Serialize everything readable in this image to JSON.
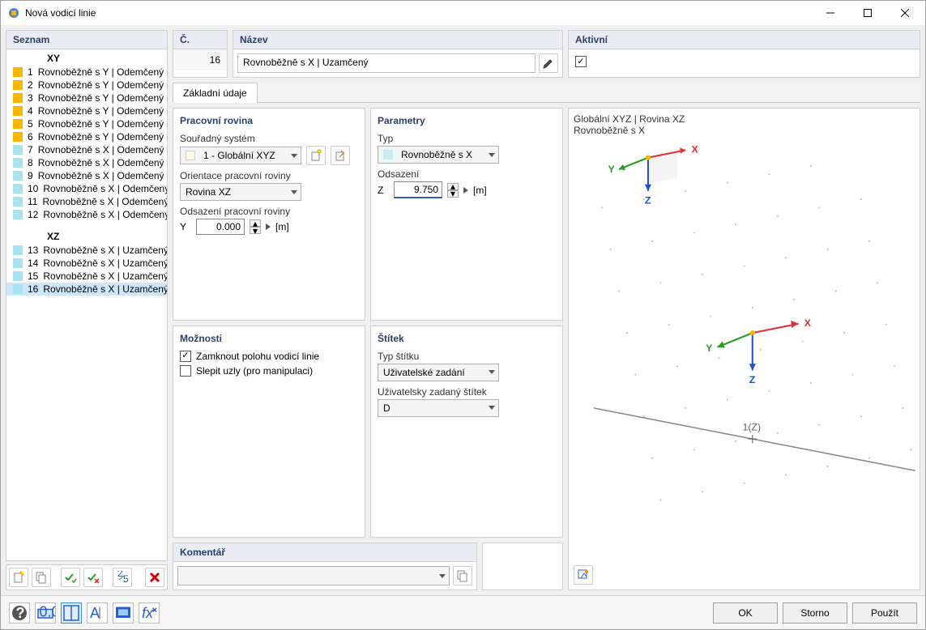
{
  "window": {
    "title": "Nová vodicí linie"
  },
  "left": {
    "header": "Seznam",
    "group_xy": "XY",
    "group_xz": "XZ",
    "xy_items": [
      {
        "idx": "1",
        "label": "Rovnoběžně s Y | Odemčený"
      },
      {
        "idx": "2",
        "label": "Rovnoběžně s Y | Odemčený"
      },
      {
        "idx": "3",
        "label": "Rovnoběžně s Y | Odemčený"
      },
      {
        "idx": "4",
        "label": "Rovnoběžně s Y | Odemčený"
      },
      {
        "idx": "5",
        "label": "Rovnoběžně s Y | Odemčený"
      },
      {
        "idx": "6",
        "label": "Rovnoběžně s Y | Odemčený"
      },
      {
        "idx": "7",
        "label": "Rovnoběžně s X | Odemčený"
      },
      {
        "idx": "8",
        "label": "Rovnoběžně s X | Odemčený"
      },
      {
        "idx": "9",
        "label": "Rovnoběžně s X | Odemčený"
      },
      {
        "idx": "10",
        "label": "Rovnoběžně s X | Odemčený"
      },
      {
        "idx": "11",
        "label": "Rovnoběžně s X | Odemčený"
      },
      {
        "idx": "12",
        "label": "Rovnoběžně s X | Odemčený"
      }
    ],
    "xz_items": [
      {
        "idx": "13",
        "label": "Rovnoběžně s X | Uzamčený"
      },
      {
        "idx": "14",
        "label": "Rovnoběžně s X | Uzamčený"
      },
      {
        "idx": "15",
        "label": "Rovnoběžně s X | Uzamčený"
      },
      {
        "idx": "16",
        "label": "Rovnoběžně s X | Uzamčený"
      }
    ]
  },
  "top": {
    "num_header": "Č.",
    "num_value": "16",
    "name_header": "Název",
    "name_value": "Rovnoběžně s X | Uzamčený",
    "active_header": "Aktivní"
  },
  "tab": {
    "label": "Základní údaje"
  },
  "workplane": {
    "header": "Pracovní rovina",
    "cs_label": "Souřadný systém",
    "cs_value": "1 - Globální XYZ",
    "orient_label": "Orientace pracovní roviny",
    "orient_value": "Rovina XZ",
    "offset_label": "Odsazení pracovní roviny",
    "offset_axis": "Y",
    "offset_value": "0.000",
    "offset_unit": "[m]"
  },
  "params": {
    "header": "Parametry",
    "type_label": "Typ",
    "type_value": "Rovnoběžně s X",
    "offset_label": "Odsazení",
    "offset_axis": "Z",
    "offset_value": "9.750",
    "offset_unit": "[m]"
  },
  "options": {
    "header": "Možnosti",
    "lock_label": "Zamknout polohu vodicí linie",
    "glue_label": "Slepit uzly (pro manipulaci)"
  },
  "tag": {
    "header": "Štítek",
    "type_label": "Typ štítku",
    "type_value": "Uživatelské zadání",
    "user_label": "Uživatelsky zadaný štítek",
    "user_value": "D"
  },
  "preview": {
    "l1": "Globální XYZ | Rovina XZ",
    "l2": "Rovnoběžně s X",
    "axis_x": "X",
    "axis_y": "Y",
    "axis_z": "Z",
    "marker": "1(Z)"
  },
  "comment": {
    "header": "Komentář"
  },
  "footer": {
    "ok": "OK",
    "cancel": "Storno",
    "apply": "Použít"
  }
}
